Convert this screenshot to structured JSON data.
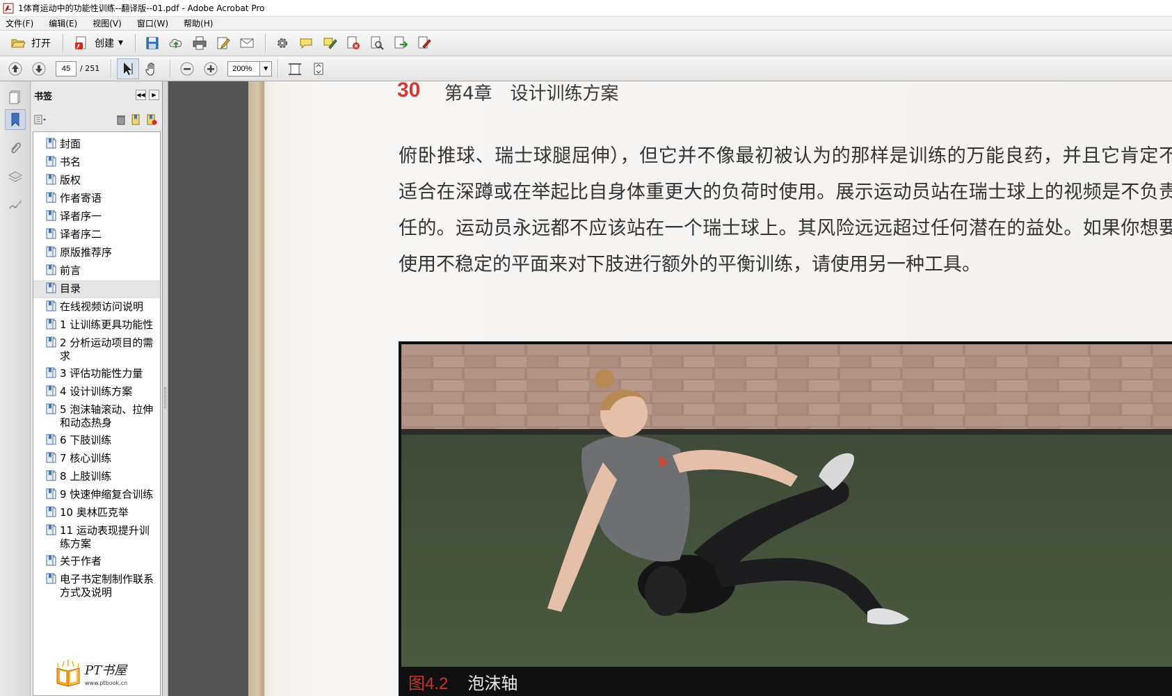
{
  "window": {
    "title": "1体育运动中的功能性训练--翻译版--01.pdf - Adobe Acrobat Pro"
  },
  "menu": [
    "文件(F)",
    "编辑(E)",
    "视图(V)",
    "窗口(W)",
    "帮助(H)"
  ],
  "toolbar": {
    "open_label": "打开",
    "create_label": "创建"
  },
  "nav": {
    "current_page": "45",
    "total_pages": "/ 251",
    "zoom": "200%"
  },
  "bookmarks": {
    "header": "书签",
    "items": [
      "封面",
      "书名",
      "版权",
      "作者寄语",
      "译者序一",
      "译者序二",
      "原版推荐序",
      "前言",
      "目录",
      "在线视频访问说明",
      "1 让训练更具功能性",
      "2 分析运动项目的需求",
      "3 评估功能性力量",
      "4 设计训练方案",
      "5 泡沫轴滚动、拉伸和动态热身",
      "6 下肢训练",
      "7 核心训练",
      "8 上肢训练",
      "9 快速伸缩复合训练",
      "10 奥林匹克举",
      "11 运动表现提升训练方案",
      "关于作者",
      "电子书定制制作联系方式及说明"
    ],
    "selected_index": 8
  },
  "logo": {
    "name": "PT书屋",
    "url": "www.ptbook.cn"
  },
  "page": {
    "page_number": "30",
    "chapter": "第4章　设计训练方案",
    "body": "俯卧推球、瑞士球腿屈伸），但它并不像最初被认为的那样是训练的万能良药，并且它肯定不适合在深蹲或在举起比自身体重更大的负荷时使用。展示运动员站在瑞士球上的视频是不负责任的。运动员永远都不应该站在一个瑞士球上。其风险远远超过任何潜在的益处。如果你想要使用不稳定的平面来对下肢进行额外的平衡训练，请使用另一种工具。",
    "figure_label": "图4.2",
    "figure_caption": "泡沫轴"
  },
  "colors": {
    "accent_red": "#d33a3a",
    "doc_bg": "#545454",
    "panel_bg": "#e9e9e9"
  }
}
